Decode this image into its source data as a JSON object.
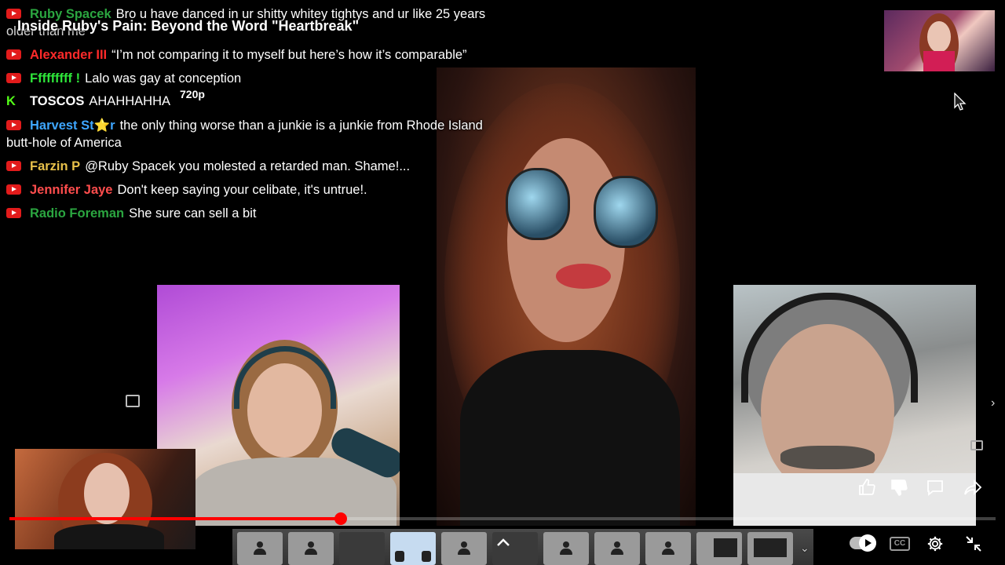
{
  "stream": {
    "title": "Inside Ruby's Pain: Beyond the Word \"Heartbreak\"",
    "quality_label": "720p",
    "progress_fraction": 0.336
  },
  "chat": [
    {
      "platform": "youtube",
      "author": "Ruby Spacek",
      "author_color": "#2ba640",
      "message": "Bro u have danced in ur shitty whitey tightys and ur like 25 years",
      "continuation": "older than me"
    },
    {
      "platform": "youtube",
      "author": "Alexander III",
      "author_color": "#ff2a2a",
      "message": "“I’m not comparing it to myself but here’s how it’s comparable”"
    },
    {
      "platform": "youtube",
      "author": "Fffffffff !",
      "author_color": "#2ee63a",
      "message": "Lalo was gay at conception"
    },
    {
      "platform": "kick",
      "badge": "K",
      "author": "TOSCOS",
      "author_color": "#ffffff",
      "message": "AHAHHAHHA"
    },
    {
      "platform": "youtube",
      "author": "Harvest St⭐r",
      "author_color": "#3ea6ff",
      "message": "the only thing worse than a junkie is a junkie from Rhode Island",
      "continuation": "butt-hole of America"
    },
    {
      "platform": "youtube",
      "author": "Farzin P",
      "author_color": "#e8c14a",
      "message": "@Ruby Spacek you molested a retarded man. Shame!..."
    },
    {
      "platform": "youtube",
      "author": "Jennifer Jaye",
      "author_color": "#ff4d4d",
      "message": "Don't keep saying your celibate, it's untrue!."
    },
    {
      "platform": "youtube",
      "author": "Radio Foreman",
      "author_color": "#2ba640",
      "message": "She sure can sell a bit"
    }
  ],
  "controls": {
    "like_icon": "thumbs-up-icon",
    "dislike_icon": "thumbs-down-icon",
    "comment_icon": "comment-icon",
    "share_icon": "share-icon",
    "cc_icon": "closed-captions-icon",
    "settings_icon": "gear-icon",
    "exit_fullscreen_icon": "exit-fullscreen-icon",
    "play_icon": "play-icon"
  }
}
